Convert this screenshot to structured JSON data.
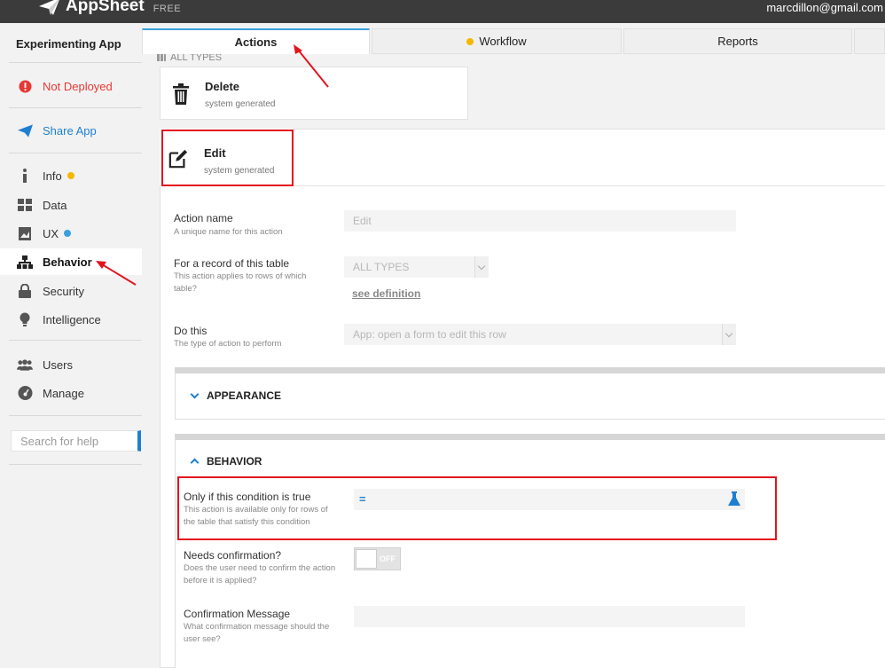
{
  "header": {
    "brand": "AppSheet",
    "plan": "FREE",
    "user_email": "marcdillon@gmail.com"
  },
  "sidebar": {
    "app_name": "Experimenting App",
    "status": "Not Deployed",
    "share": "Share App",
    "items": [
      {
        "label": "Info",
        "dot": "#f5b800"
      },
      {
        "label": "Data"
      },
      {
        "label": "UX",
        "dot": "#3aa0e0"
      },
      {
        "label": "Behavior"
      },
      {
        "label": "Security"
      },
      {
        "label": "Intelligence"
      }
    ],
    "admin": [
      {
        "label": "Users"
      },
      {
        "label": "Manage"
      }
    ],
    "search_placeholder": "Search for help"
  },
  "tabs": [
    {
      "label": "Actions"
    },
    {
      "label": "Workflow"
    },
    {
      "label": "Reports"
    }
  ],
  "main": {
    "group_label": "ALL TYPES",
    "delete_card": {
      "title": "Delete",
      "subtitle": "system generated"
    },
    "edit_card": {
      "title": "Edit",
      "subtitle": "system generated"
    },
    "action_name": {
      "label": "Action name",
      "hint": "A unique name for this action",
      "value": "Edit"
    },
    "record_table": {
      "label": "For a record of this table",
      "hint": "This action applies to rows of which table?",
      "value": "ALL TYPES",
      "link": "see definition"
    },
    "do_this": {
      "label": "Do this",
      "hint": "The type of action to perform",
      "value": "App: open a form to edit this row"
    },
    "appearance": {
      "title": "APPEARANCE"
    },
    "behavior": {
      "title": "BEHAVIOR"
    },
    "condition": {
      "label": "Only if this condition is true",
      "hint": "This action is available only for rows of the table that satisfy this condition",
      "prefix": "="
    },
    "confirmation": {
      "label": "Needs confirmation?",
      "hint": "Does the user need to confirm the action before it is applied?",
      "toggle": "OFF"
    },
    "confirm_message": {
      "label": "Confirmation Message",
      "hint": "What confirmation message should the user see?"
    }
  },
  "colors": {
    "accent": "#1e7fd0",
    "highlight": "#e4141e",
    "warning": "#e53935",
    "topbar": "#3b3b3b"
  }
}
